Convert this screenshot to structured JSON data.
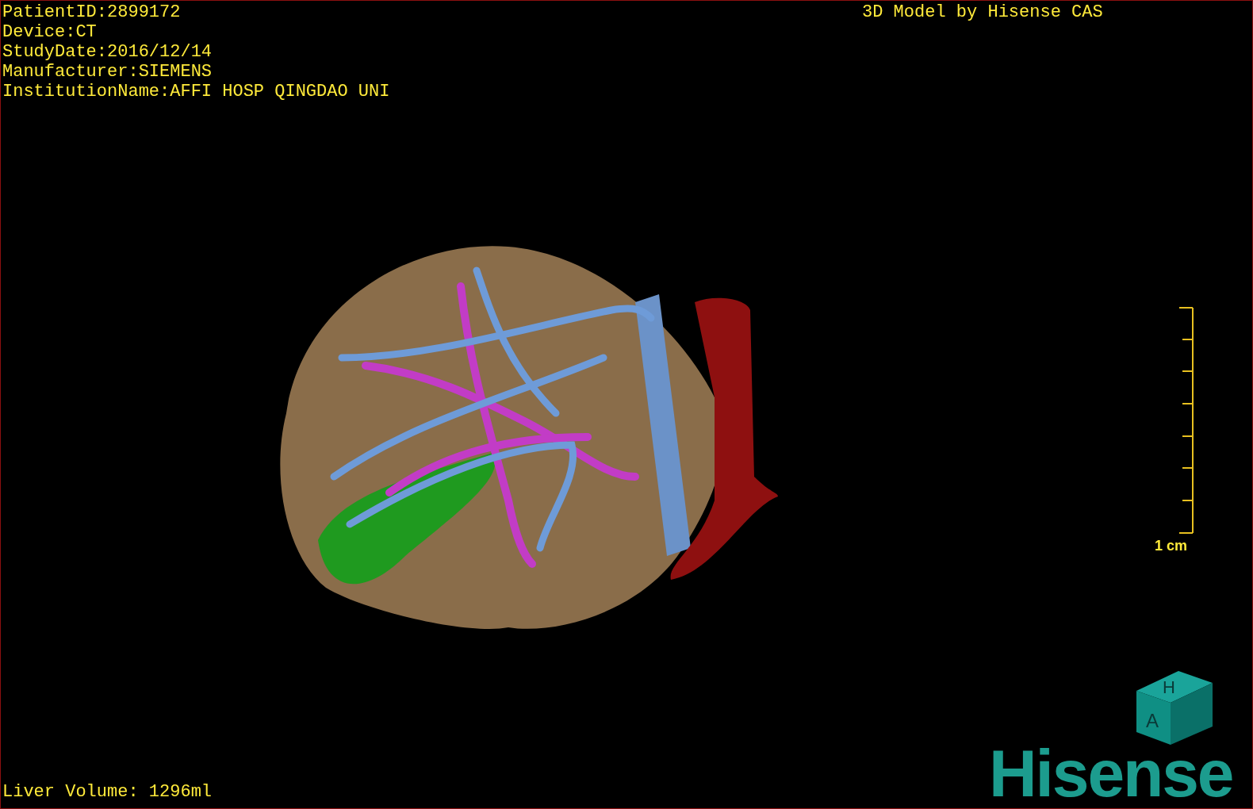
{
  "info_lines": [
    "PatientID:2899172",
    "Device:CT",
    "StudyDate:2016/12/14",
    "Manufacturer:SIEMENS",
    "InstitutionName:AFFI HOSP QINGDAO UNI"
  ],
  "credit": "3D Model by Hisense CAS",
  "scale": {
    "label": "1 cm"
  },
  "orientation_cube": {
    "faces": [
      "H",
      "A"
    ]
  },
  "logo": "Hisense",
  "volume": "Liver Volume: 1296ml"
}
